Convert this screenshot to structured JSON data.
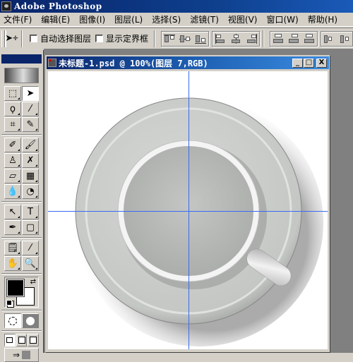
{
  "app": {
    "title": "Adobe Photoshop"
  },
  "menu": [
    {
      "label": "文件(F)"
    },
    {
      "label": "编辑(E)"
    },
    {
      "label": "图像(I)"
    },
    {
      "label": "图层(L)"
    },
    {
      "label": "选择(S)"
    },
    {
      "label": "滤镜(T)"
    },
    {
      "label": "视图(V)"
    },
    {
      "label": "窗口(W)"
    },
    {
      "label": "帮助(H)"
    }
  ],
  "options_bar": {
    "tool_icon": "move-tool-icon",
    "auto_select_layer": {
      "label": "自动选择图层",
      "checked": false
    },
    "show_bounding_box": {
      "label": "显示定界框",
      "checked": false
    },
    "align_groups": [
      [
        "align-top-edges",
        "align-vertical-centers",
        "align-bottom-edges"
      ],
      [
        "align-left-edges",
        "align-horizontal-centers",
        "align-right-edges"
      ],
      [
        "distribute-top",
        "distribute-vertical-centers",
        "distribute-bottom"
      ],
      [
        "distribute-left",
        "distribute-horizontal-centers"
      ]
    ]
  },
  "toolbox": {
    "tools": [
      {
        "name": "marquee",
        "glyph": "⬚",
        "active": false
      },
      {
        "name": "move",
        "glyph": "➤",
        "active": true
      },
      {
        "name": "lasso",
        "glyph": "ϙ",
        "active": false
      },
      {
        "name": "magic-wand",
        "glyph": "⁄",
        "active": false
      },
      {
        "name": "crop",
        "glyph": "⌗",
        "active": false
      },
      {
        "name": "slice",
        "glyph": "✎",
        "active": false
      },
      {
        "name": "healing-brush",
        "glyph": "✐",
        "active": false
      },
      {
        "name": "brush",
        "glyph": "🖌",
        "active": false
      },
      {
        "name": "clone-stamp",
        "glyph": "♙",
        "active": false
      },
      {
        "name": "history-brush",
        "glyph": "✗",
        "active": false
      },
      {
        "name": "eraser",
        "glyph": "▱",
        "active": false
      },
      {
        "name": "gradient",
        "glyph": "▦",
        "active": false
      },
      {
        "name": "blur",
        "glyph": "💧",
        "active": false
      },
      {
        "name": "dodge",
        "glyph": "◔",
        "active": false
      },
      {
        "name": "path-selection",
        "glyph": "↖",
        "active": false
      },
      {
        "name": "type",
        "glyph": "T",
        "active": false
      },
      {
        "name": "pen",
        "glyph": "✒",
        "active": false
      },
      {
        "name": "rectangle-shape",
        "glyph": "▢",
        "active": false
      },
      {
        "name": "notes",
        "glyph": "🗒",
        "active": false
      },
      {
        "name": "eyedropper",
        "glyph": "⁄",
        "active": false
      },
      {
        "name": "hand",
        "glyph": "✋",
        "active": false
      },
      {
        "name": "zoom",
        "glyph": "🔍",
        "active": false
      }
    ],
    "foreground_color": "#000000",
    "background_color": "#ffffff"
  },
  "document": {
    "title": "未标题-1.psd @ 100%(图层 7,RGB)",
    "zoom": "100%",
    "layer": "图层 7",
    "mode": "RGB",
    "controls": {
      "minimize": "_",
      "maximize": "□",
      "close": "X"
    }
  }
}
